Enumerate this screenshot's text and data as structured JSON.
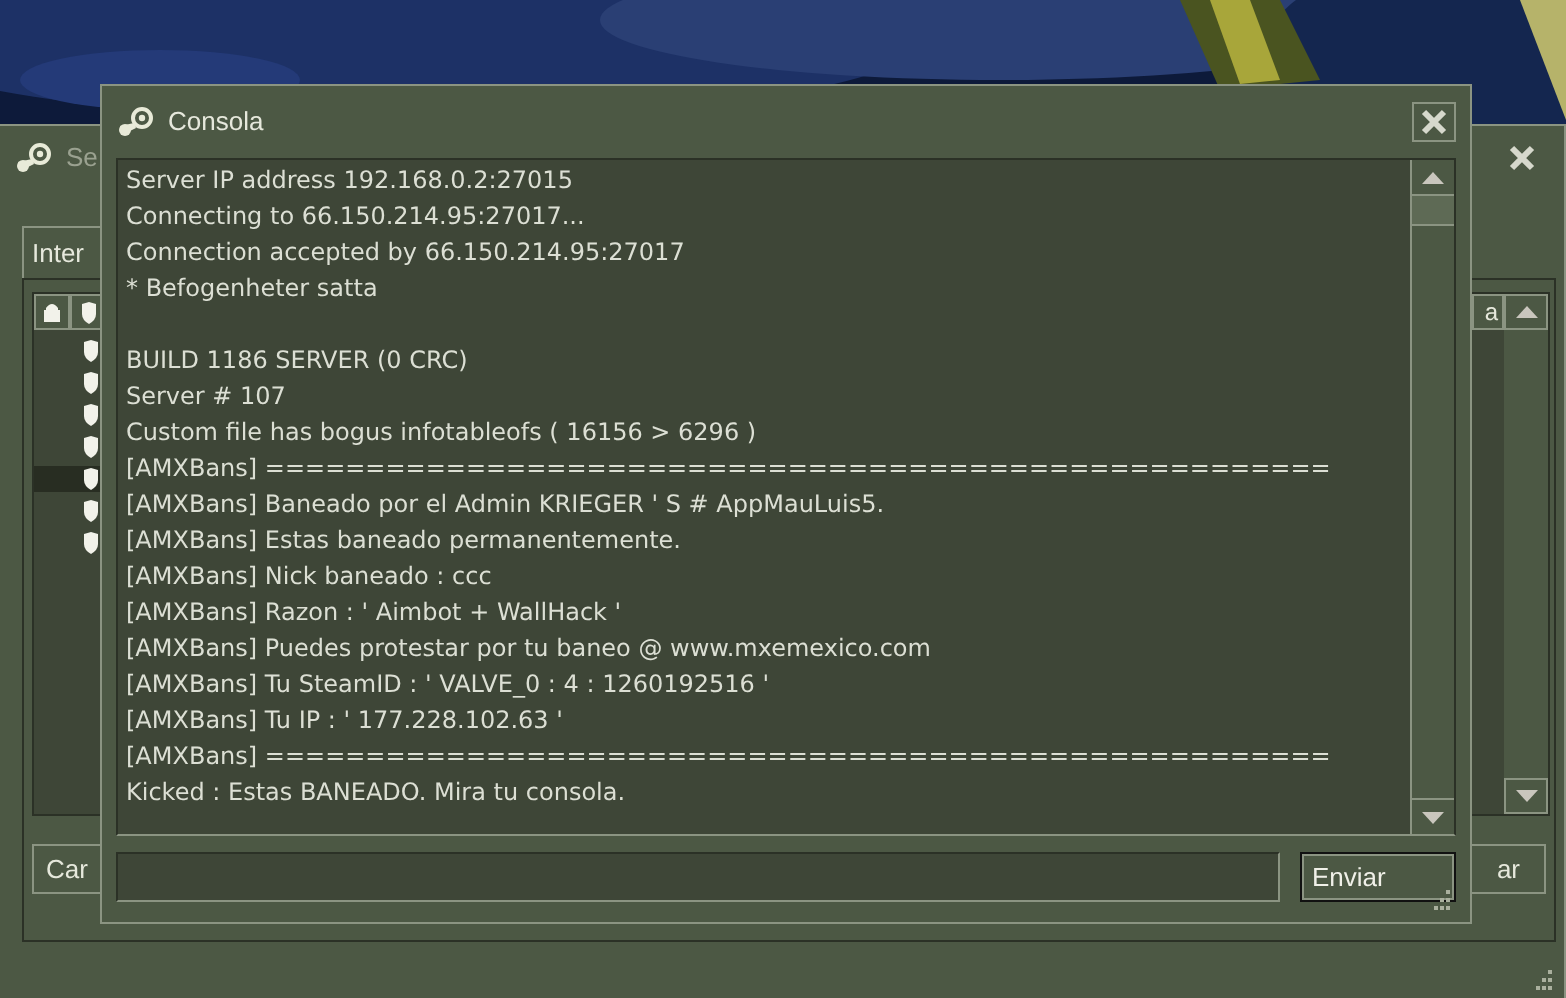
{
  "background_window": {
    "title": "Se",
    "tab": "Inter",
    "column_header": "a",
    "rows": [
      {
        "selected": false
      },
      {
        "selected": false
      },
      {
        "selected": false
      },
      {
        "selected": false
      },
      {
        "selected": true
      },
      {
        "selected": false
      },
      {
        "selected": false
      }
    ],
    "buttons": [
      "Car",
      "ar"
    ]
  },
  "console_window": {
    "title": "Consola",
    "output_blocks": [
      [
        "Server IP address 192.168.0.2:27015",
        "Connecting to 66.150.214.95:27017...",
        "Connection accepted by 66.150.214.95:27017",
        "* Befogenheter satta"
      ],
      [
        "BUILD 1186 SERVER (0 CRC)",
        "Server # 107",
        "Custom file has bogus infotableofs ( 16156 > 6296 )",
        "[AMXBans] =====================================================",
        "[AMXBans] Baneado por el Admin KRIEGER ' S # AppMauLuis5.",
        "[AMXBans] Estas baneado permanentemente.",
        "[AMXBans] Nick baneado : ccc",
        "[AMXBans] Razon : ' Aimbot + WallHack '",
        "[AMXBans] Puedes protestar por tu baneo @ www.mxemexico.com",
        "[AMXBans] Tu SteamID : ' VALVE_0 : 4 : 1260192516 '",
        "[AMXBans] Tu IP : ' 177.228.102.63 '",
        "[AMXBans] =====================================================",
        "Kicked : Estas BANEADO. Mira tu consola."
      ]
    ],
    "send_button": "Enviar"
  }
}
